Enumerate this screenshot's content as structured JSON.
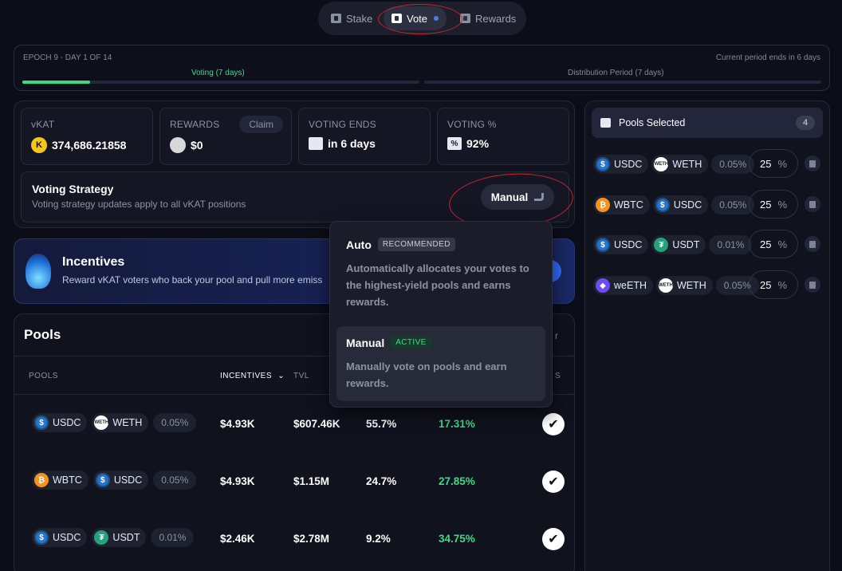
{
  "nav": {
    "tabs": [
      {
        "label": "Stake",
        "icon": "lock-icon"
      },
      {
        "label": "Vote",
        "icon": "ticket-icon"
      },
      {
        "label": "Rewards",
        "icon": "reward-icon"
      }
    ]
  },
  "epoch": {
    "label": "EPOCH 9 - DAY 1 OF 14",
    "period_note": "Current period ends in 6 days",
    "voting_label": "Voting (7 days)",
    "distribution_label": "Distribution Period (7 days)",
    "voting_progress": 0.17
  },
  "stats": {
    "vkat": {
      "label": "vKAT",
      "value": "374,686.21858"
    },
    "rewards": {
      "label": "REWARDS",
      "value": "$0",
      "claim_label": "Claim"
    },
    "voting_ends": {
      "label": "VOTING ENDS",
      "value": "in 6 days"
    },
    "voting_pct": {
      "label": "VOTING %",
      "value": "92%"
    }
  },
  "strategy": {
    "title": "Voting Strategy",
    "subtitle": "Voting strategy updates apply to all vKAT positions",
    "selected": "Manual"
  },
  "incentives": {
    "title": "Incentives",
    "subtitle": "Reward vKAT voters who back your pool and pull more emiss"
  },
  "pools_table": {
    "title": "Pools",
    "headers": {
      "pools": "POOLS",
      "incentives": "INCENTIVES",
      "tvl": "TVL",
      "last": "S"
    },
    "rows": [
      {
        "token_a": "USDC",
        "token_b": "WETH",
        "fee": "0.05%",
        "incentives": "$4.93K",
        "tvl": "$607.46K",
        "share": "55.7%",
        "apr": "17.31%"
      },
      {
        "token_a": "WBTC",
        "token_b": "USDC",
        "fee": "0.05%",
        "incentives": "$4.93K",
        "tvl": "$1.15M",
        "share": "24.7%",
        "apr": "27.85%"
      },
      {
        "token_a": "USDC",
        "token_b": "USDT",
        "fee": "0.01%",
        "incentives": "$2.46K",
        "tvl": "$2.78M",
        "share": "9.2%",
        "apr": "34.75%"
      }
    ]
  },
  "dropdown": {
    "auto": {
      "title": "Auto",
      "badge": "RECOMMENDED",
      "desc": "Automatically allocates your votes to the highest-yield pools and earns rewards."
    },
    "manual": {
      "title": "Manual",
      "badge": "ACTIVE",
      "desc": "Manually vote on pools and earn rewards."
    }
  },
  "selected_pools": {
    "title": "Pools Selected",
    "count": "4",
    "items": [
      {
        "token_a": "USDC",
        "token_b": "WETH",
        "fee": "0.05%",
        "pct": "25",
        "unit": "%"
      },
      {
        "token_a": "WBTC",
        "token_b": "USDC",
        "fee": "0.05%",
        "pct": "25",
        "unit": "%"
      },
      {
        "token_a": "USDC",
        "token_b": "USDT",
        "fee": "0.01%",
        "pct": "25",
        "unit": "%"
      },
      {
        "token_a": "weETH",
        "token_b": "WETH",
        "fee": "0.05%",
        "pct": "25",
        "unit": "%"
      }
    ]
  },
  "colors": {
    "accent_green": "#3ddc84",
    "annotation_red": "#c9262e",
    "background": "#0b0d18"
  }
}
